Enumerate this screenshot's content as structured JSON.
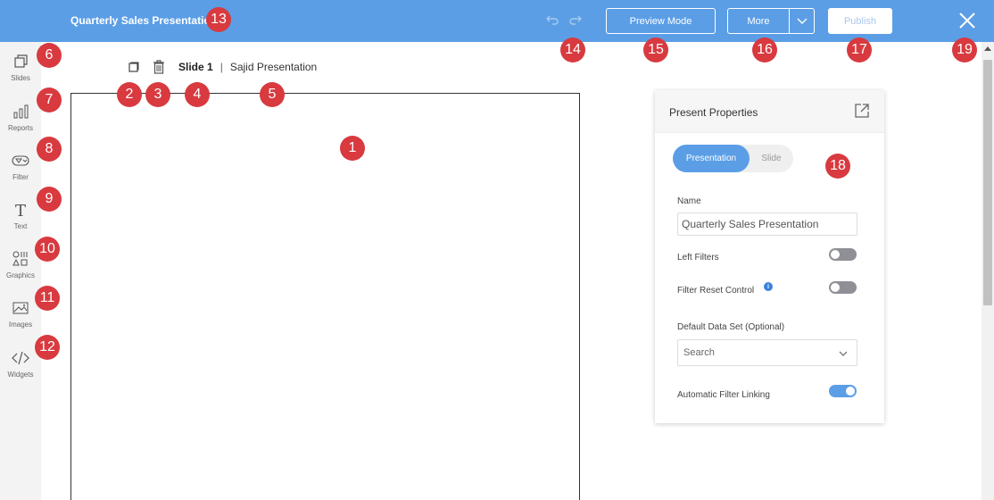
{
  "header": {
    "title": "Quarterly Sales Presentation",
    "preview_label": "Preview Mode",
    "more_label": "More",
    "publish_label": "Publish"
  },
  "sidebar": {
    "items": [
      {
        "label": "Slides",
        "icon": "slides-icon"
      },
      {
        "label": "Reports",
        "icon": "bar-chart-icon"
      },
      {
        "label": "Filter",
        "icon": "filter-icon"
      },
      {
        "label": "Text",
        "icon": "text-icon"
      },
      {
        "label": "Graphics",
        "icon": "shapes-icon"
      },
      {
        "label": "Images",
        "icon": "image-icon"
      },
      {
        "label": "Widgets",
        "icon": "code-icon"
      }
    ]
  },
  "slide_toolbar": {
    "slide_name": "Slide 1",
    "separator": "|",
    "presentation_name": "Sajid Presentation"
  },
  "properties": {
    "title": "Present Properties",
    "tabs": [
      "Presentation",
      "Slide"
    ],
    "active_tab": "Presentation",
    "name_label": "Name",
    "name_value": "Quarterly Sales Presentation",
    "left_filters_label": "Left Filters",
    "left_filters_on": false,
    "filter_reset_label": "Filter Reset Control",
    "filter_reset_on": false,
    "info_glyph": "i",
    "dataset_label": "Default Data Set (Optional)",
    "dataset_placeholder": "Search",
    "auto_link_label": "Automatic Filter Linking",
    "auto_link_on": true
  },
  "markers": [
    "1",
    "2",
    "3",
    "4",
    "5",
    "6",
    "7",
    "8",
    "9",
    "10",
    "11",
    "12",
    "13",
    "14",
    "15",
    "16",
    "17",
    "18",
    "19"
  ],
  "colors": {
    "topbar": "#5b9ee6",
    "marker": "#d83a3f",
    "toggle_off": "#8f8f96",
    "toggle_on": "#5b9ee6"
  }
}
